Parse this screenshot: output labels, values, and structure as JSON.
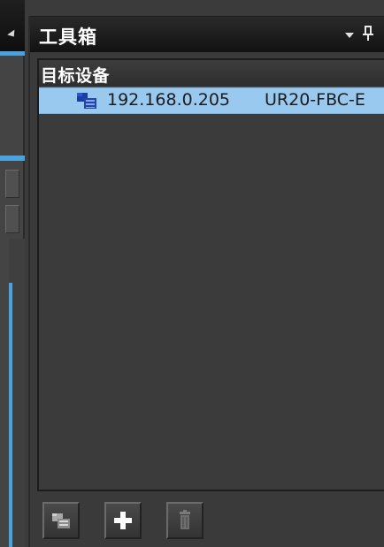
{
  "toolbox": {
    "title": "工具箱",
    "controls": {
      "dropdown_icon": "chevron-down-icon",
      "pin_icon": "pin-icon"
    }
  },
  "tree": {
    "header": "目标设备",
    "items": [
      {
        "icon": "network-device-icon",
        "ip": "192.168.0.205",
        "model": "UR20-FBC-E",
        "selected": true
      }
    ]
  },
  "toolbar": {
    "buttons": [
      {
        "icon": "network-device-icon",
        "enabled": true
      },
      {
        "icon": "plus-icon",
        "enabled": true
      },
      {
        "icon": "trash-icon",
        "enabled": false
      }
    ]
  },
  "colors": {
    "selection": "#99c9ef",
    "accent": "#4aa3df",
    "panel_bg": "#3a3a3a",
    "header_bg": "#121212"
  }
}
